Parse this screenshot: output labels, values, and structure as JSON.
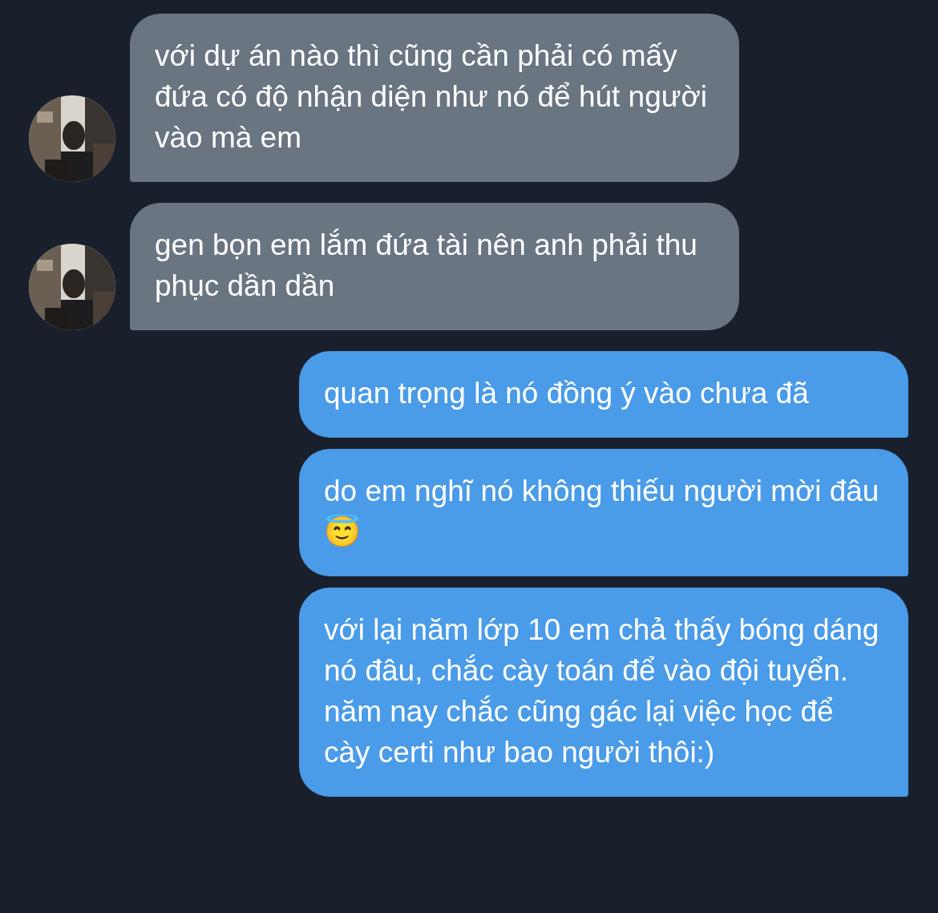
{
  "messages": [
    {
      "kind": "incoming",
      "text": "với dự án nào thì cũng cần phải có mấy đứa có độ nhận diện như nó để hút người vào mà em"
    },
    {
      "kind": "incoming",
      "text": "gen bọn em lắm đứa tài nên anh phải thu phục dần dần"
    },
    {
      "kind": "outgoing",
      "text": "quan trọng là nó đồng ý vào chưa đã"
    },
    {
      "kind": "outgoing",
      "text": "do em nghĩ nó không thiếu người mời đâu😇"
    },
    {
      "kind": "outgoing",
      "text": "với lại năm lớp 10 em chả thấy bóng dáng nó đâu, chắc cày toán để vào đội tuyển. năm nay chắc cũng gác lại việc học để cày certi như bao người thôi:)"
    }
  ]
}
